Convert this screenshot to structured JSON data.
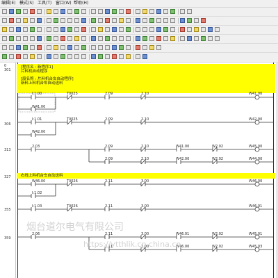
{
  "menu": [
    "编辑(E)",
    "模式(S)",
    "工具(T)",
    "窗口(W)",
    "帮助(H)"
  ],
  "gutter": [
    "0",
    "301",
    "306",
    "313",
    "327",
    "355",
    "359"
  ],
  "rung1": {
    "title_line1": "[程序名 : 新程序1]",
    "title_line2": "片料机自动程序",
    "sub_line1": "[段名称 : 片料机台车自动程序]",
    "sub_line2": "新料上料机台车自动送料"
  },
  "rung1_row1": {
    "c1": "I:1.00",
    "c2": "T0025",
    "c3": "2.09",
    "c4": "2.10",
    "out": "W41.00"
  },
  "rung1_row2": {
    "c1": "W41.00"
  },
  "rung2_row1": {
    "c1": "I:1.01",
    "c2": "T0025",
    "c3": "2.09",
    "c4": "2.10",
    "out": "W42.00"
  },
  "rung2_row2": {
    "c1": "W42.00"
  },
  "rung3_row1": {
    "c1": "2.03",
    "c2": "2.09",
    "c3": "2.10",
    "c4": "W41.00",
    "c5": "W2.02",
    "out": "W45.00"
  },
  "rung3_row2": {
    "c2": "2.09",
    "c3": "2.10",
    "c4": "W42.00",
    "c5": "W2.02",
    "out": "W44.00"
  },
  "section2": {
    "title": "右线上料机台车自动送料"
  },
  "rung4_row1": {
    "c1": "W46.00",
    "c2": "T0026",
    "c3": "2.11",
    "c4": "3.00",
    "out": "W46.00"
  },
  "rung4_row2": {
    "c1": "I:1.02"
  },
  "rung5_row1": {
    "c1": "I:1.03",
    "c2": "T0026",
    "c3": "2.11",
    "c4": "3.00",
    "out": "W46.01"
  },
  "rung6_row1": {
    "c1": "2.06",
    "c2": "2.11",
    "c3": "3.00",
    "c4": "W46.01",
    "c5": "W2.02",
    "out": "W45.01"
  },
  "rung6_row2": {
    "c2": "2.11",
    "c3": "3.00",
    "c4": "W46.00",
    "c5": "W2.02",
    "out": "W45.03"
  },
  "watermark": {
    "line1": "烟台道尔电气有限公司",
    "line2": "https://ytthlik.cn.china.cn"
  },
  "icons": {
    "toolbar_icons": [
      "file-new-icon",
      "open-folder-icon",
      "save-icon",
      "print-icon",
      "cut-icon",
      "copy-icon",
      "paste-icon",
      "undo-icon",
      "search-icon",
      "help-icon",
      "zoom-icon",
      "grid-icon",
      "contact-no-icon",
      "contact-nc-icon",
      "coil-icon",
      "line-icon",
      "run-icon",
      "stop-icon",
      "monitor-icon",
      "transfer-icon"
    ]
  }
}
